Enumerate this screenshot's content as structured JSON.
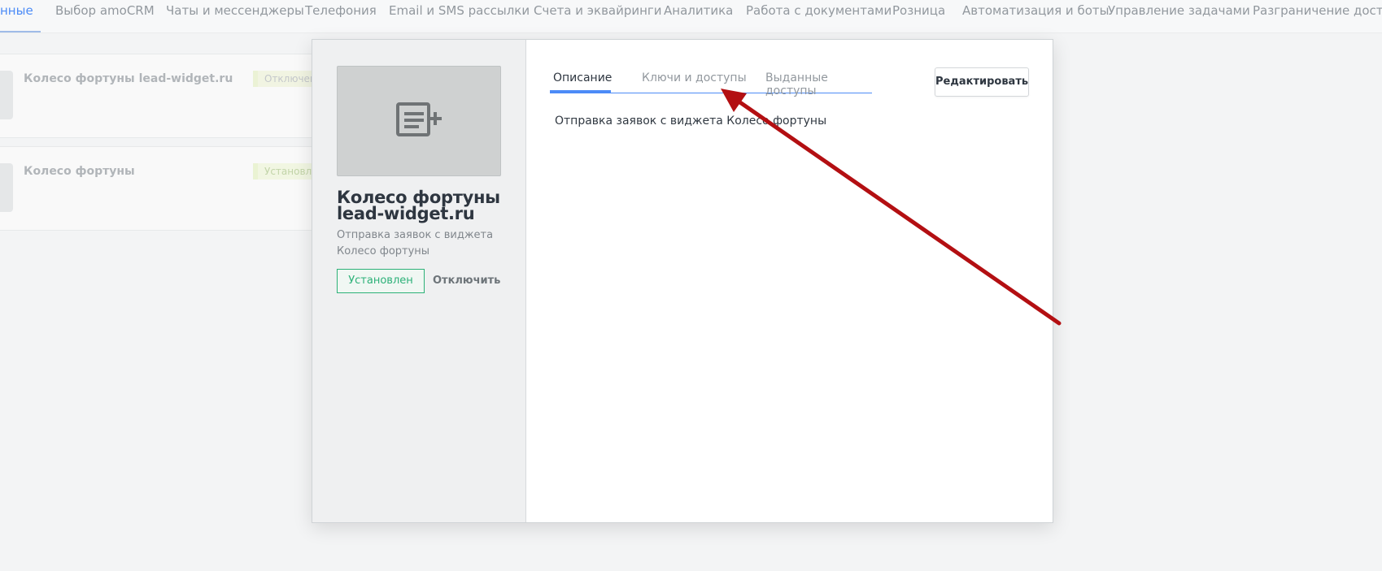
{
  "topnav": {
    "tabs": [
      {
        "label": "нные",
        "active": true
      },
      {
        "label": "Выбор amoCRM"
      },
      {
        "label": "Чаты и мессенджеры"
      },
      {
        "label": "Телефония"
      },
      {
        "label": "Email и SMS рассылки"
      },
      {
        "label": "Счета и эквайринги"
      },
      {
        "label": "Аналитика"
      },
      {
        "label": "Работа с документами"
      },
      {
        "label": "Розница"
      },
      {
        "label": "Автоматизация и боты"
      },
      {
        "label": "Управление задачами"
      },
      {
        "label": "Разграничение доступа"
      }
    ]
  },
  "list": {
    "rows": [
      {
        "title": "Колесо фортуны lead-widget.ru",
        "status": "Отключено"
      },
      {
        "title": "Колесо фортуны",
        "status": "Установлен"
      }
    ]
  },
  "modal": {
    "widget_title": "Колесо фортуны lead-widget.ru",
    "widget_desc": "Отправка заявок с виджета Колесо фортуны",
    "installed_label": "Установлен",
    "disable_label": "Отключить",
    "tabs": [
      "Описание",
      "Ключи и доступы",
      "Выданные доступы"
    ],
    "edit_label": "Редактировать",
    "description": "Отправка заявок с виджета Колесо фортуны"
  },
  "colors": {
    "accent": "#4c8bf7",
    "installed": "#2cb178",
    "arrow": "#b30f12"
  }
}
